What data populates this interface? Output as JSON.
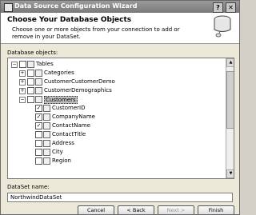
{
  "window": {
    "title": "Data Source Configuration Wizard",
    "help": "?",
    "close": "✕"
  },
  "header": {
    "heading": "Choose Your Database Objects",
    "description": "Choose one or more objects from your connection to add or remove in your DataSet."
  },
  "objects_label": "Database objects:",
  "tree": [
    {
      "label": "Tables",
      "level": 0,
      "expander": "−",
      "checkbox": "",
      "icon": "tables-icon"
    },
    {
      "label": "Categories",
      "level": 1,
      "expander": "+",
      "checkbox": "",
      "icon": "table-icon"
    },
    {
      "label": "CustomerCustomerDemo",
      "level": 1,
      "expander": "+",
      "checkbox": "",
      "icon": "table-icon"
    },
    {
      "label": "CustomerDemographics",
      "level": 1,
      "expander": "+",
      "checkbox": "",
      "icon": "table-icon"
    },
    {
      "label": "Customers",
      "level": 1,
      "expander": "−",
      "checkbox": "",
      "icon": "table-icon",
      "selected": true
    },
    {
      "label": "CustomerID",
      "level": 2,
      "expander": "",
      "checkbox": "✓",
      "icon": "column-icon"
    },
    {
      "label": "CompanyName",
      "level": 2,
      "expander": "",
      "checkbox": "✓",
      "icon": "column-icon"
    },
    {
      "label": "ContactName",
      "level": 2,
      "expander": "",
      "checkbox": "✓",
      "icon": "column-icon"
    },
    {
      "label": "ContactTitle",
      "level": 2,
      "expander": "",
      "checkbox": "",
      "icon": "column-icon"
    },
    {
      "label": "Address",
      "level": 2,
      "expander": "",
      "checkbox": "",
      "icon": "column-icon"
    },
    {
      "label": "City",
      "level": 2,
      "expander": "",
      "checkbox": "",
      "icon": "column-icon"
    },
    {
      "label": "Region",
      "level": 2,
      "expander": "",
      "checkbox": "",
      "icon": "column-icon"
    }
  ],
  "dataset": {
    "label": "DataSet name:",
    "value": "NorthwindDataSet"
  },
  "buttons": {
    "cancel": "Cancel",
    "back": "< Back",
    "next": "Next >",
    "finish": "Finish"
  }
}
